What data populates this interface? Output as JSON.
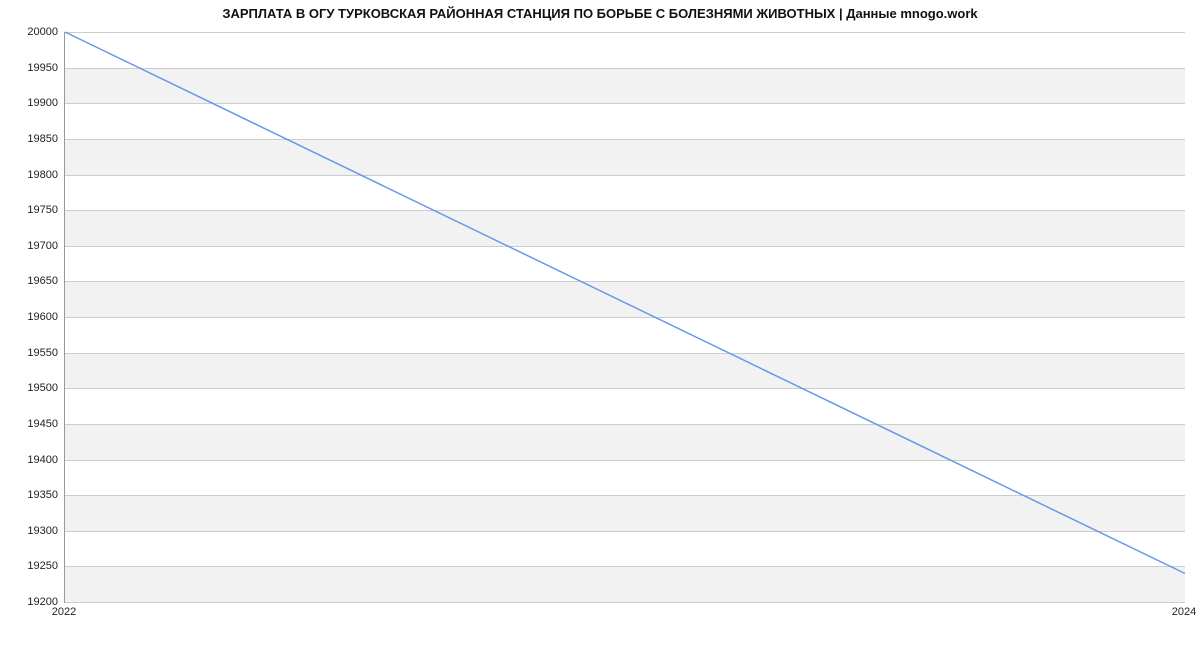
{
  "chart_data": {
    "type": "line",
    "title": "ЗАРПЛАТА В ОГУ ТУРКОВСКАЯ РАЙОННАЯ СТАНЦИЯ ПО БОРЬБЕ С БОЛЕЗНЯМИ  ЖИВОТНЫХ | Данные mnogo.work",
    "x": [
      2022,
      2024
    ],
    "values": [
      20000,
      19240
    ],
    "xlabel": "",
    "ylabel": "",
    "x_ticks": [
      2022,
      2024
    ],
    "y_ticks": [
      19200,
      19250,
      19300,
      19350,
      19400,
      19450,
      19500,
      19550,
      19600,
      19650,
      19700,
      19750,
      19800,
      19850,
      19900,
      19950,
      20000
    ],
    "xlim": [
      2022,
      2024
    ],
    "ylim": [
      19200,
      20000
    ],
    "grid": true,
    "line_color": "#6699e8"
  }
}
